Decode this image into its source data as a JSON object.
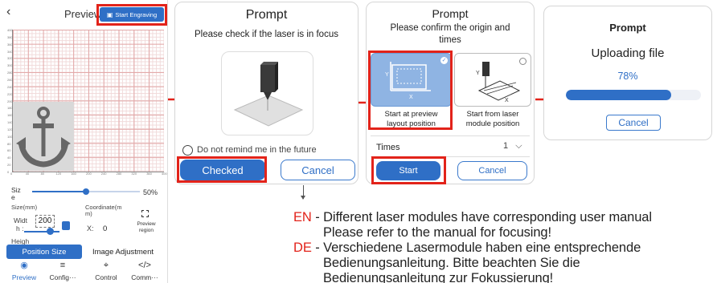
{
  "screen1": {
    "back_icon": "chevron-left-icon",
    "title": "Preview",
    "start_engraving": "Start Engraving",
    "size_label": "Siz",
    "size_label_2": "e",
    "size_percent": "50%",
    "size_slider_value": 0.5,
    "size_mm_label": "Size(mm)",
    "coordinate_label": "Coordinate(m",
    "coordinate_label_2": "m)",
    "width_label": "Widt",
    "width_label_2": "h :",
    "width_value": "200",
    "height_label": "Heigh",
    "x_label": "X:",
    "x_value": "0",
    "preview_region": "Preview region",
    "tabs": [
      "Position Size",
      "Image Adjustment"
    ],
    "nav": [
      {
        "label": "Preview",
        "icon": "eye-icon"
      },
      {
        "label": "Config···",
        "icon": "sliders-icon"
      },
      {
        "label": "Control",
        "icon": "crosshair-icon"
      },
      {
        "label": "Comm···",
        "icon": "code-icon"
      }
    ],
    "y_ticks": [
      "400",
      "380",
      "360",
      "340",
      "320",
      "300",
      "280",
      "260",
      "240",
      "220",
      "200",
      "180",
      "160",
      "140",
      "120",
      "100",
      "80",
      "60",
      "40",
      "20",
      "0"
    ],
    "x_ticks": [
      "0",
      "40",
      "80",
      "120",
      "160",
      "200",
      "240",
      "280",
      "320",
      "360",
      "400"
    ]
  },
  "screen2": {
    "title": "Prompt",
    "message": "Please check if the laser is in focus",
    "checkbox_label": "Do not remind me in the future",
    "checked_button": "Checked",
    "cancel_button": "Cancel"
  },
  "screen3": {
    "title": "Prompt",
    "message_line1": "Please confirm the origin and",
    "message_line2": "times",
    "option1_line1": "Start at preview",
    "option1_line2": "layout position",
    "option2_line1": "Start from laser",
    "option2_line2": "module position",
    "times_label": "Times",
    "times_value": "1",
    "start_button": "Start",
    "cancel_button": "Cancel"
  },
  "screen4": {
    "title": "Prompt",
    "message": "Uploading file",
    "progress_text": "78%",
    "progress_value": 0.78,
    "cancel_button": "Cancel"
  },
  "notes": {
    "en_code": "EN",
    "en_line1": " - Different laser modules have corresponding user manual",
    "en_line2": "Please refer to the manual for focusing!",
    "de_code": "DE",
    "de_line1": " - Verschiedene Lasermodule haben eine entsprechende",
    "de_line2": "Bedienungsanleitung. Bitte beachten Sie die",
    "de_line3": "Bedienungsanleitung zur Fokussierung!"
  },
  "colors": {
    "primary": "#2f6fc6",
    "highlight_red": "#e2231a",
    "selected_tile": "#8fb4e3"
  }
}
